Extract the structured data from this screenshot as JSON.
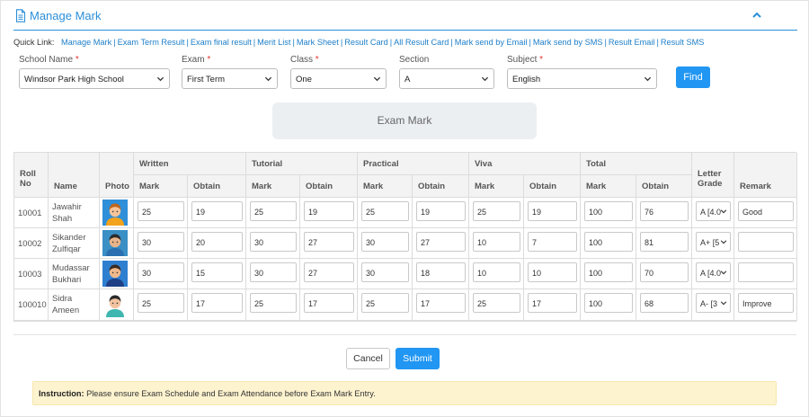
{
  "header": {
    "title": "Manage Mark"
  },
  "quick_links": {
    "label": "Quick Link:",
    "items": [
      "Manage Mark",
      "Exam Term Result",
      "Exam final result",
      "Merit List",
      "Mark Sheet",
      "Result Card",
      "All Result Card",
      "Mark send by Email",
      "Mark send by SMS",
      "Result Email",
      "Result SMS"
    ]
  },
  "filters": {
    "school": {
      "label": "School Name",
      "required": "*",
      "value": "Windsor Park High School"
    },
    "exam": {
      "label": "Exam",
      "required": "*",
      "value": "First Term"
    },
    "class": {
      "label": "Class",
      "required": "*",
      "value": "One"
    },
    "section": {
      "label": "Section",
      "value": "A"
    },
    "subject": {
      "label": "Subject",
      "required": "*",
      "value": "English"
    },
    "find_label": "Find"
  },
  "exam_mark_label": "Exam Mark",
  "table": {
    "headers": {
      "roll_no": "Roll No",
      "name": "Name",
      "photo": "Photo",
      "written": "Written",
      "tutorial": "Tutorial",
      "practical": "Practical",
      "viva": "Viva",
      "total": "Total",
      "mark": "Mark",
      "obtain": "Obtain",
      "letter_grade": "Letter Grade",
      "remark": "Remark"
    },
    "rows": [
      {
        "roll": "10001",
        "name1": "Jawahir",
        "name2": "Shah",
        "written_mark": "25",
        "written_obtain": "19",
        "tutorial_mark": "25",
        "tutorial_obtain": "19",
        "practical_mark": "25",
        "practical_obtain": "19",
        "viva_mark": "25",
        "viva_obtain": "19",
        "total_mark": "100",
        "total_obtain": "76",
        "grade": "A [4.0",
        "remark": "Good"
      },
      {
        "roll": "10002",
        "name1": "Sikander",
        "name2": "Zulfiqar",
        "written_mark": "30",
        "written_obtain": "20",
        "tutorial_mark": "30",
        "tutorial_obtain": "27",
        "practical_mark": "30",
        "practical_obtain": "27",
        "viva_mark": "10",
        "viva_obtain": "7",
        "total_mark": "100",
        "total_obtain": "81",
        "grade": "A+ [5",
        "remark": ""
      },
      {
        "roll": "10003",
        "name1": "Mudassar",
        "name2": "Bukhari",
        "written_mark": "30",
        "written_obtain": "15",
        "tutorial_mark": "30",
        "tutorial_obtain": "27",
        "practical_mark": "30",
        "practical_obtain": "18",
        "viva_mark": "10",
        "viva_obtain": "10",
        "total_mark": "100",
        "total_obtain": "70",
        "grade": "A [4.0",
        "remark": ""
      },
      {
        "roll": "100010",
        "name1": "Sidra",
        "name2": "Ameen",
        "written_mark": "25",
        "written_obtain": "17",
        "tutorial_mark": "25",
        "tutorial_obtain": "17",
        "practical_mark": "25",
        "practical_obtain": "17",
        "viva_mark": "25",
        "viva_obtain": "17",
        "total_mark": "100",
        "total_obtain": "68",
        "grade": "A- [3",
        "remark": "Improve"
      }
    ]
  },
  "actions": {
    "cancel": "Cancel",
    "submit": "Submit"
  },
  "instruction": {
    "label": "Instruction:",
    "text": "Please ensure Exam Schedule and Exam Attendance before Exam Mark Entry."
  },
  "colors": {
    "accent": "#2196f3",
    "link": "#1d7fc9",
    "instruction_bg": "#fdf3cf"
  },
  "icons": {
    "title": "document-icon",
    "collapse": "chevron-up-icon",
    "select": "chevron-down-icon"
  }
}
